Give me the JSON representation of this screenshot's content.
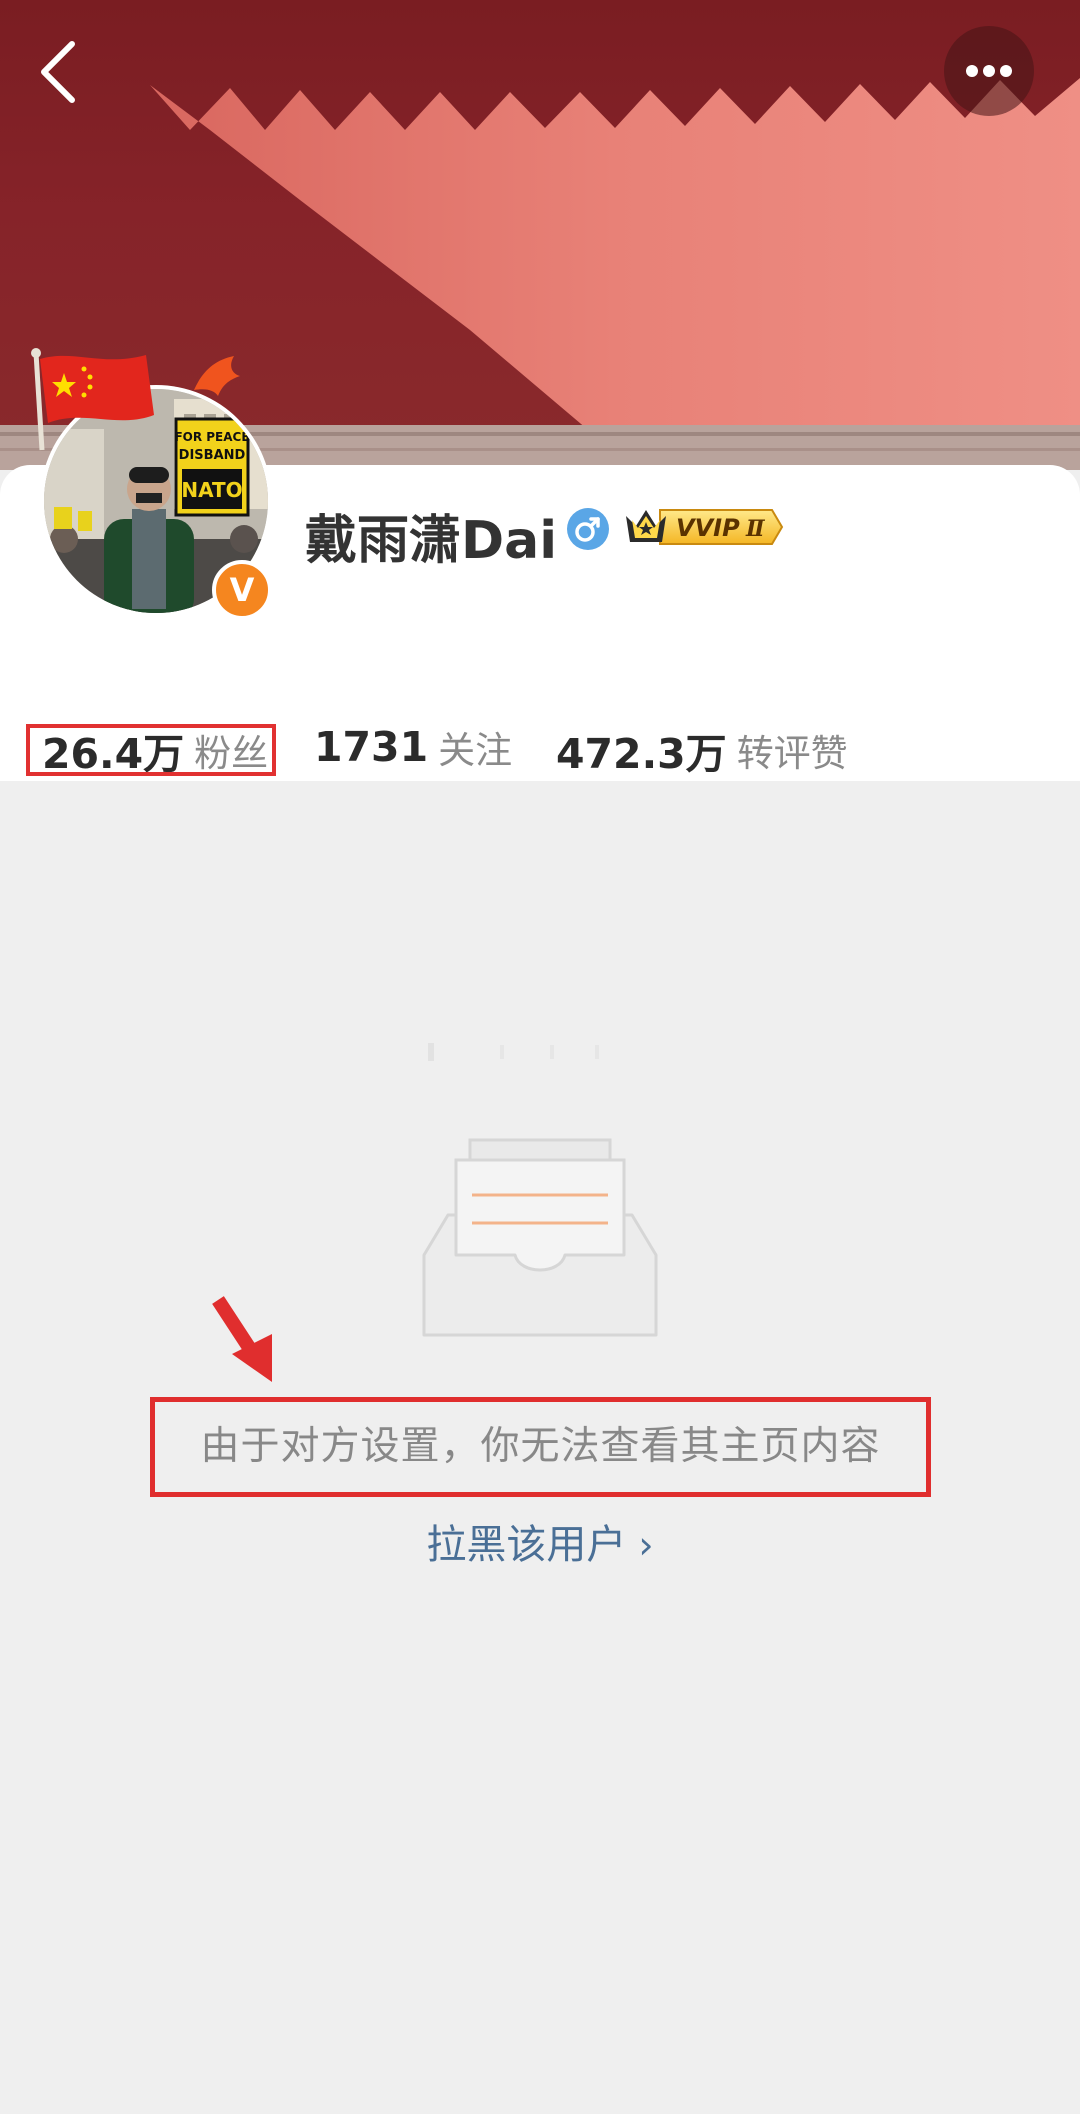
{
  "header": {
    "back_icon": "chevron-left-icon",
    "more_icon": "ellipsis-icon"
  },
  "profile": {
    "name": "戴雨潇Dai",
    "gender_icon": "male-icon",
    "verified_icon": "verified-v-icon",
    "vip_badge": "VVIP",
    "vip_level": "Ⅱ",
    "avatar_sign_lines": [
      "FOR PEACE",
      "DISBAND",
      "NATO"
    ]
  },
  "stats": {
    "followers": {
      "value": "26.4万",
      "label": "粉丝"
    },
    "following": {
      "value": "1731",
      "label": "关注"
    },
    "interactions": {
      "value": "472.3万",
      "label": "转评赞"
    }
  },
  "empty_state": {
    "message": "由于对方设置，你无法查看其主页内容",
    "block_link": "拉黑该用户",
    "block_chevron": "›"
  },
  "colors": {
    "banner_red": "#862329",
    "wall_pink": "#e8827a",
    "annotation_red": "#e02e2e",
    "link_blue": "#4a6f96",
    "verified_orange": "#f5861f"
  }
}
